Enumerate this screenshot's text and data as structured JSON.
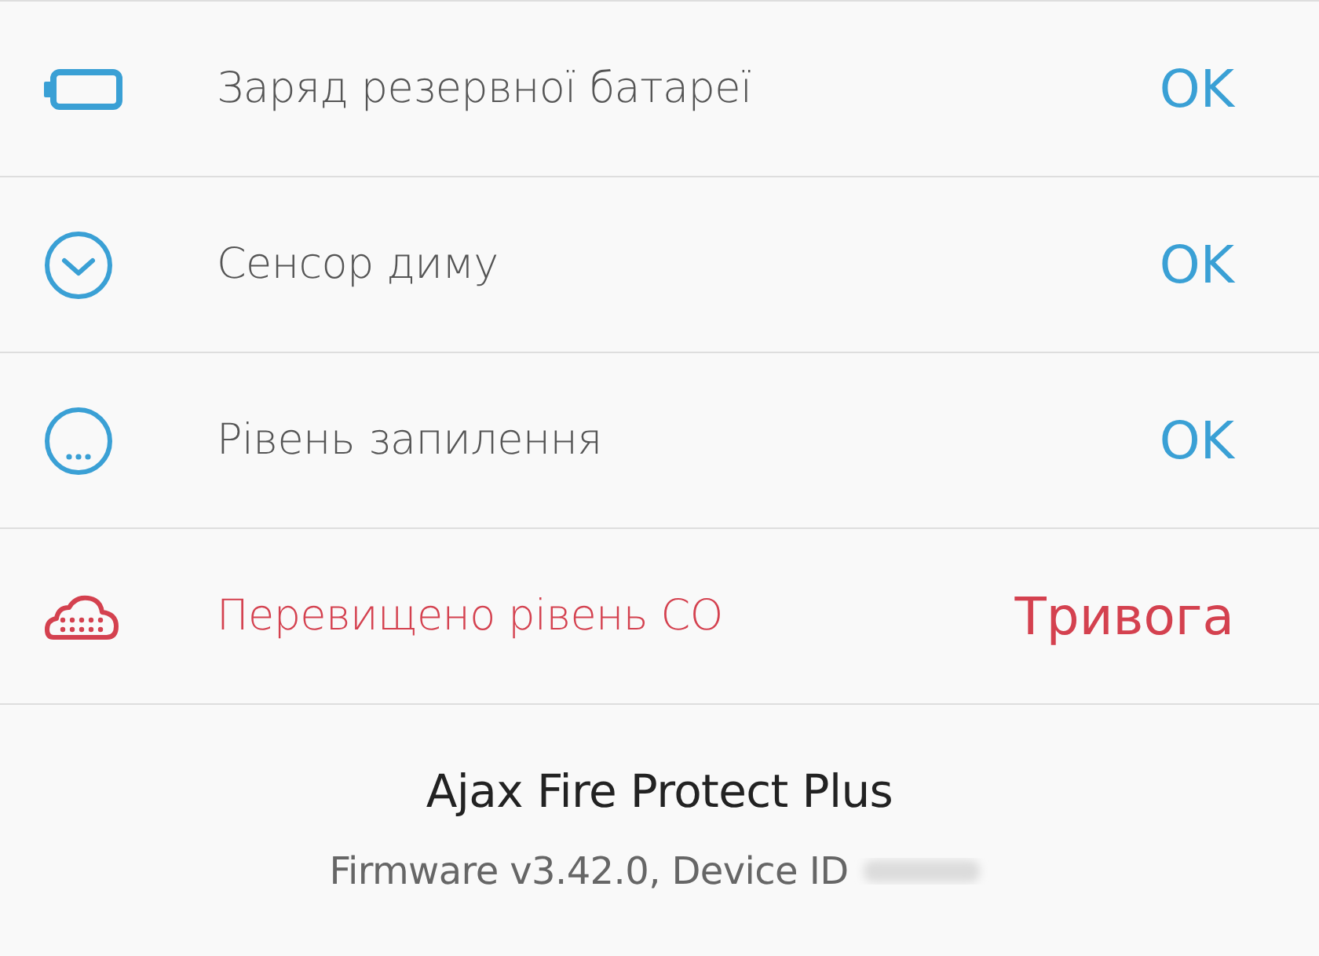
{
  "rows": [
    {
      "kind": "battery",
      "label": "Заряд резервної батареї",
      "status": "OK",
      "alert": false
    },
    {
      "kind": "smoke",
      "label": "Сенсор диму",
      "status": "OK",
      "alert": false
    },
    {
      "kind": "dust",
      "label": "Рівень запилення",
      "status": "OK",
      "alert": false
    },
    {
      "kind": "co",
      "label": "Перевищено рівень CO",
      "status": "Тривога",
      "alert": true
    }
  ],
  "footer": {
    "device_name": "Ajax Fire Protect Plus",
    "firmware": "Firmware v3.42.0, Device ID"
  }
}
